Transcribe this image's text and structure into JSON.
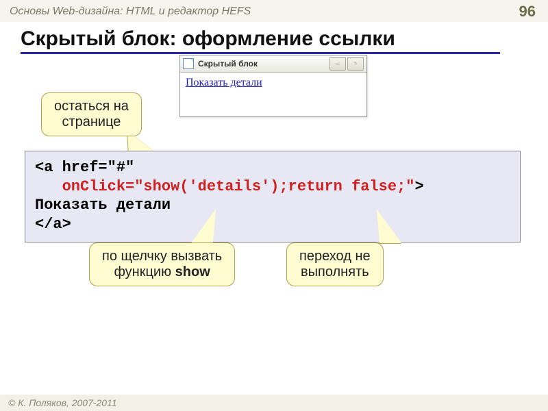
{
  "header": {
    "course": "Основы Web-дизайна: HTML и редактор HEFS",
    "page": "96"
  },
  "title": "Скрытый блок: оформление ссылки",
  "browser": {
    "tab_title": "Скрытый блок",
    "link_text": "Показать детали"
  },
  "code": {
    "l1a": "<a href=\"#\"",
    "l2_indent": "   ",
    "l2_red": "onClick=\"show('details');return false;\"",
    "l2_tail": ">",
    "l3": "Показать детали",
    "l4": "</a>"
  },
  "callouts": {
    "stay_on_page_l1": "остаться на",
    "stay_on_page_l2": "странице",
    "on_click_l1": "по щелчку вызвать",
    "on_click_l2a": "функцию ",
    "on_click_l2b": "show",
    "no_nav_l1": "переход не",
    "no_nav_l2": "выполнять"
  },
  "footer": "© К. Поляков, 2007-2011"
}
